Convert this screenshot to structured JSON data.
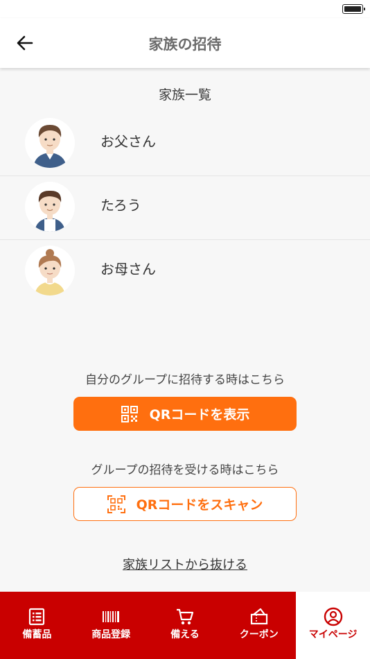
{
  "header": {
    "title": "家族の招待",
    "back_icon": "arrow-left-icon"
  },
  "family": {
    "section_title": "家族一覧",
    "members": [
      {
        "name": "お父さん",
        "avatar": "father-avatar"
      },
      {
        "name": "たろう",
        "avatar": "boy-avatar"
      },
      {
        "name": "お母さん",
        "avatar": "mother-avatar"
      }
    ]
  },
  "invite": {
    "show_prompt": "自分のグループに招待する時はこちら",
    "show_button": "QRコードを表示",
    "scan_prompt": "グループの招待を受ける時はこちら",
    "scan_button": "QRコードをスキャン"
  },
  "leave_link": "家族リストから抜ける",
  "tabs": [
    {
      "label": "備蓄品",
      "icon": "list-icon",
      "active": false
    },
    {
      "label": "商品登録",
      "icon": "barcode-icon",
      "active": false
    },
    {
      "label": "備える",
      "icon": "cart-icon",
      "active": false
    },
    {
      "label": "クーポン",
      "icon": "coupon-icon",
      "active": false
    },
    {
      "label": "マイページ",
      "icon": "user-circle-icon",
      "active": true
    }
  ],
  "colors": {
    "accent": "#ff6f0f",
    "tabbar": "#c90000",
    "background": "#f7f7f7"
  }
}
